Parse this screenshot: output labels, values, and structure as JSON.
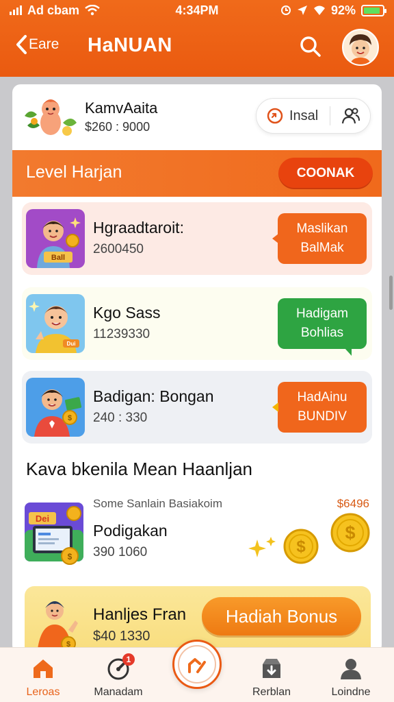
{
  "status_bar": {
    "carrier": "Ad cbam",
    "time": "4:34PM",
    "battery": "92%"
  },
  "nav": {
    "back_label": "Eare",
    "title": "HaNUAN"
  },
  "profile": {
    "name": "KamvAaita",
    "balance": "$260 : 9000",
    "install_label": "Insal"
  },
  "level": {
    "title": "Level Harjan",
    "button": "COONAK"
  },
  "tasks": [
    {
      "title": "Hgraadtaroit:",
      "sub": "2600450",
      "btn_line1": "Maslikan",
      "btn_line2": "BalMak",
      "btn_color": "#f0661c",
      "thumb_label": "Ball"
    },
    {
      "title": "Kgo Sass",
      "sub": "11239330",
      "btn_line1": "Hadigam",
      "btn_line2": "Bohlias",
      "btn_color": "#2ea442",
      "thumb_label": "Dui"
    },
    {
      "title": "Badigan: Bongan",
      "sub": "240 : 330",
      "btn_line1": "HadAinu",
      "btn_line2": "BUNDIV",
      "btn_color": "#f0661c"
    }
  ],
  "section": {
    "heading": "Kava bkenila  Mean Haanljan"
  },
  "promo": {
    "caption": "Some Sanlain Basiakoim",
    "price": "$6496",
    "title": "Podigakan",
    "sub": "390 1060",
    "thumb_label": "Dei"
  },
  "bonus": {
    "title": "Hanljes Fran",
    "sub": "$40 1330",
    "button": "Hadiah Bonus"
  },
  "bottom_nav": [
    {
      "label": "Leroas",
      "icon": "home-icon",
      "active": true
    },
    {
      "label": "Manadam",
      "icon": "gauge-icon",
      "badge": "1"
    },
    {
      "label": "",
      "icon": "center-home-icon"
    },
    {
      "label": "Rerblan",
      "icon": "download-box-icon"
    },
    {
      "label": "Loindne",
      "icon": "user-icon"
    }
  ],
  "colors": {
    "brand_orange": "#ef6418",
    "green": "#2ea442",
    "bonus_yellow": "#f8dc7a"
  }
}
